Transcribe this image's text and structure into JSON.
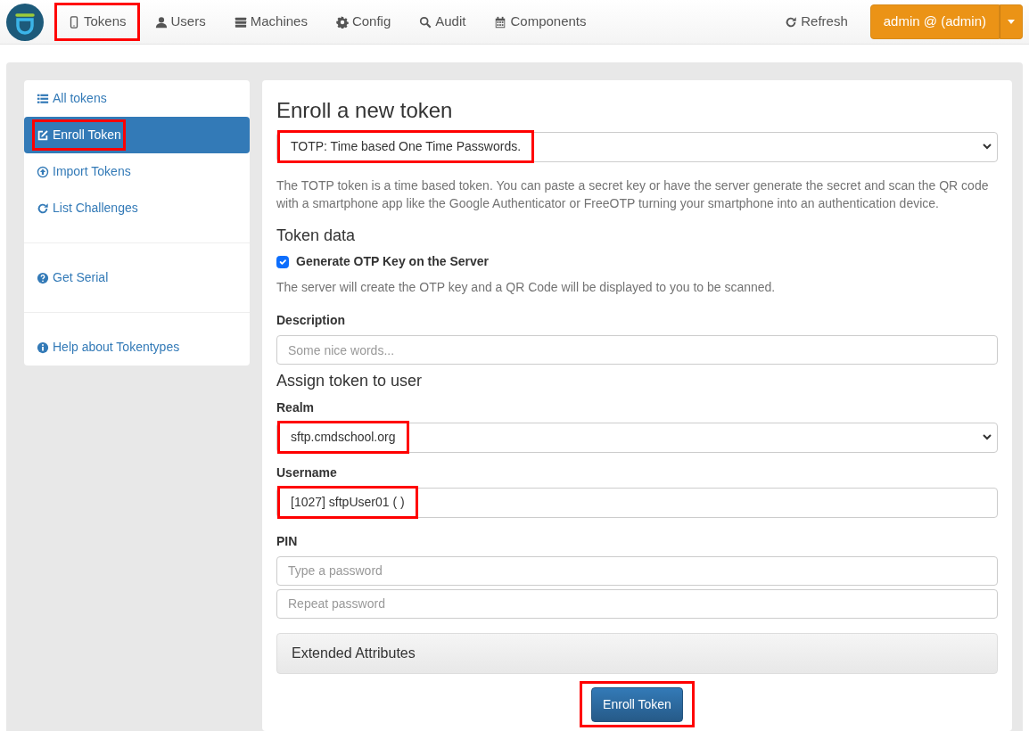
{
  "navbar": {
    "items": [
      {
        "label": "Tokens",
        "highlighted": true
      },
      {
        "label": "Users",
        "highlighted": false
      },
      {
        "label": "Machines",
        "highlighted": false
      },
      {
        "label": "Config",
        "highlighted": false
      },
      {
        "label": "Audit",
        "highlighted": false
      },
      {
        "label": "Components",
        "highlighted": false
      }
    ],
    "refresh": "Refresh",
    "user_button": "admin @ (admin)"
  },
  "sidebar": {
    "groups": [
      [
        {
          "label": "All tokens",
          "selected": false,
          "highlighted": false
        },
        {
          "label": "Enroll Token",
          "selected": true,
          "highlighted": true
        },
        {
          "label": "Import Tokens",
          "selected": false,
          "highlighted": false
        },
        {
          "label": "List Challenges",
          "selected": false,
          "highlighted": false
        }
      ],
      [
        {
          "label": "Get Serial",
          "selected": false,
          "highlighted": false
        }
      ],
      [
        {
          "label": "Help about Tokentypes",
          "selected": false,
          "highlighted": false
        }
      ]
    ]
  },
  "form": {
    "title": "Enroll a new token",
    "token_type": {
      "value": "TOTP: Time based One Time Passwords.",
      "highlighted": true
    },
    "description_text": "The TOTP token is a time based token. You can paste a secret key or have the server generate the secret and scan the QR code with a smartphone app like the Google Authenticator or FreeOTP turning your smartphone into an authentication device.",
    "token_data_heading": "Token data",
    "generate_key": {
      "label": "Generate OTP Key on the Server",
      "checked": true
    },
    "generate_help": "The server will create the OTP key and a QR Code will be displayed to you to be scanned.",
    "description": {
      "label": "Description",
      "placeholder": "Some nice words..."
    },
    "assign_heading": "Assign token to user",
    "realm": {
      "label": "Realm",
      "value": "sftp.cmdschool.org",
      "highlighted": true
    },
    "username": {
      "label": "Username",
      "value": "[1027] sftpUser01 ( )",
      "highlighted": true
    },
    "pin": {
      "label": "PIN",
      "placeholder": "Type a password",
      "repeat_placeholder": "Repeat password"
    },
    "extended": "Extended Attributes",
    "submit": {
      "label": "Enroll Token",
      "highlighted": true
    }
  }
}
